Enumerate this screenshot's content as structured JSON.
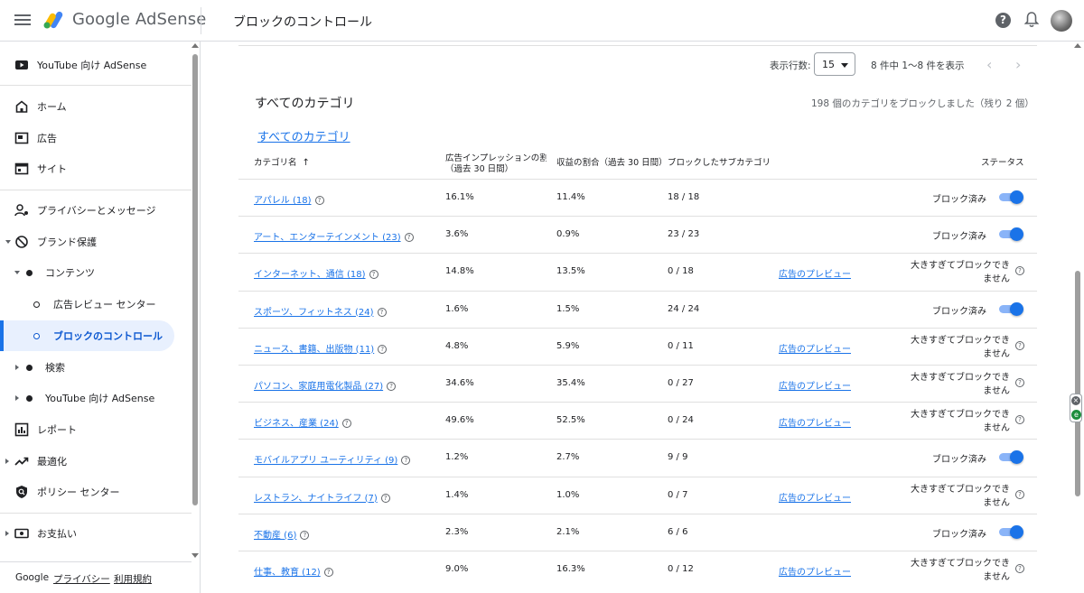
{
  "app": {
    "brand": "Google AdSense",
    "page_title": "ブロックのコントロール"
  },
  "sidebar": {
    "youtube_header": "YouTube 向け AdSense",
    "items": [
      {
        "label": "ホーム"
      },
      {
        "label": "広告"
      },
      {
        "label": "サイト"
      },
      {
        "label": "プライバシーとメッセージ"
      },
      {
        "label": "ブランド保護"
      },
      {
        "label": "コンテンツ"
      },
      {
        "label": "広告レビュー センター"
      },
      {
        "label": "ブロックのコントロール"
      },
      {
        "label": "検索"
      },
      {
        "label": "YouTube 向け AdSense"
      },
      {
        "label": "レポート"
      },
      {
        "label": "最適化"
      },
      {
        "label": "ポリシー センター"
      },
      {
        "label": "お支払い"
      }
    ],
    "footer": {
      "google": "Google",
      "privacy": "プライバシー",
      "terms": "利用規約"
    }
  },
  "pagination": {
    "rows_label": "表示行数:",
    "rows_value": "15",
    "range_text": "8 件中 1〜8 件を表示",
    "prev": "‹",
    "next": "›"
  },
  "section": {
    "title": "すべてのカテゴリ",
    "summary": "198 個のカテゴリをブロックしました（残り 2 個）",
    "link": "すべてのカテゴリ"
  },
  "table": {
    "headers": {
      "name": "カテゴリ名",
      "sort": "↑",
      "imp": "広告インプレッションの割合",
      "imp_sub": "（過去 30 日間）",
      "rev": "収益の割合（過去 30 日間）",
      "sub": "ブロックしたサブカテゴリ数",
      "status": "ステータス"
    },
    "preview_label": "広告のプレビュー",
    "status_blocked": "ブロック済み",
    "status_big_1": "大きすぎてブロックでき",
    "status_big_2": "ません",
    "help": "?",
    "rows": [
      {
        "name": "アパレル (18)",
        "imp": "16.1%",
        "rev": "11.4%",
        "sub": "18 / 18"
      },
      {
        "name": "アート、エンターテインメント (23)",
        "imp": "3.6%",
        "rev": "0.9%",
        "sub": "23 / 23"
      },
      {
        "name": "インターネット、通信 (18)",
        "imp": "14.8%",
        "rev": "13.5%",
        "sub": "0 / 18"
      },
      {
        "name": "スポーツ、フィットネス (24)",
        "imp": "1.6%",
        "rev": "1.5%",
        "sub": "24 / 24"
      },
      {
        "name": "ニュース、書籍、出版物 (11)",
        "imp": "4.8%",
        "rev": "5.9%",
        "sub": "0 / 11"
      },
      {
        "name": "パソコン、家庭用電化製品 (27)",
        "imp": "34.6%",
        "rev": "35.4%",
        "sub": "0 / 27"
      },
      {
        "name": "ビジネス、産業 (24)",
        "imp": "49.6%",
        "rev": "52.5%",
        "sub": "0 / 24"
      },
      {
        "name": "モバイルアプリ ユーティリティ (9)",
        "imp": "1.2%",
        "rev": "2.7%",
        "sub": "9 / 9"
      },
      {
        "name": "レストラン、ナイトライフ (7)",
        "imp": "1.4%",
        "rev": "1.0%",
        "sub": "0 / 7"
      },
      {
        "name": "不動産 (6)",
        "imp": "2.3%",
        "rev": "2.1%",
        "sub": "6 / 6"
      },
      {
        "name": "仕事、教育 (12)",
        "imp": "9.0%",
        "rev": "16.3%",
        "sub": "0 / 12"
      }
    ]
  },
  "colors": {
    "accent": "#1a73e8",
    "toggle_track": "#8ab4f8",
    "active_bg": "#e8f0fe"
  },
  "icons": [
    "menu-icon",
    "adsense-logo-icon",
    "help-icon",
    "bell-icon",
    "avatar",
    "youtube-icon",
    "home-icon",
    "ads-icon",
    "sites-icon",
    "privacy-icon",
    "brand-safety-icon",
    "reports-icon",
    "optimize-icon",
    "policy-icon",
    "payments-icon"
  ]
}
